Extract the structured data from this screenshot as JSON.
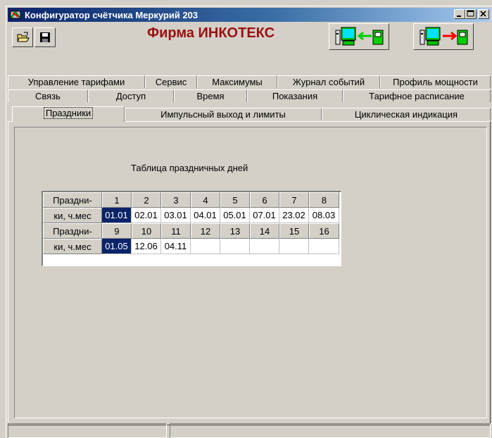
{
  "window": {
    "title": "Конфигуратор счётчика Меркурий 203"
  },
  "titlebar_buttons": {
    "minimize": "_",
    "maximize": "□",
    "close": "x"
  },
  "header": {
    "firm": "Фирма ИНКОТЕКС"
  },
  "toolbar": {
    "open_icon": "folder-open-icon",
    "save_icon": "floppy-disk-icon",
    "read_icon": "meter-to-pc-arrow-icon",
    "write_icon": "pc-to-meter-arrow-icon"
  },
  "tabs": {
    "row1": [
      "Управление тарифами",
      "Сервис",
      "Максимумы",
      "Журнал событий",
      "Профиль мощности"
    ],
    "row2": [
      "Связь",
      "Доступ",
      "Время",
      "Показания",
      "Тарифное расписание"
    ],
    "row3": [
      "Праздники",
      "Импульсный выход и лимиты",
      "Циклическая индикация"
    ],
    "active": "Праздники"
  },
  "holidays": {
    "title": "Таблица праздничных дней",
    "label_top": "Праздни-",
    "label_bottom": "ки, ч.мес",
    "row1": {
      "numbers": [
        "1",
        "2",
        "3",
        "4",
        "5",
        "6",
        "7",
        "8"
      ],
      "dates": [
        "01.01",
        "02.01",
        "03.01",
        "04.01",
        "05.01",
        "07.01",
        "23.02",
        "08.03"
      ]
    },
    "row2": {
      "numbers": [
        "9",
        "10",
        "11",
        "12",
        "13",
        "14",
        "15",
        "16"
      ],
      "dates": [
        "01.05",
        "12.06",
        "04.11",
        "",
        "",
        "",
        "",
        ""
      ]
    }
  },
  "colors": {
    "selection": "#0a246a",
    "firm_text": "#9a1010",
    "face": "#d4d0c8"
  }
}
